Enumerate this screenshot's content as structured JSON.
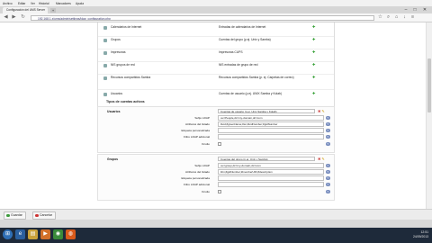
{
  "browser": {
    "menu": [
      "Archivo",
      "Editar",
      "Ver",
      "Historial",
      "Marcadores",
      "Ayuda"
    ],
    "tab_title": "Configuración del UMS Server",
    "new_tab_icon": "plus-icon",
    "url": "192.168.1.x/ums/admin/settings/ldap_configuration.php"
  },
  "settings_table": {
    "rows": [
      {
        "name": "Calendarios de Internet",
        "desc": "Entradas de calendarios de Internet"
      },
      {
        "name": "Grupos",
        "desc": "Cuentas del grupo (p.ej. Unix y Samba)"
      },
      {
        "name": "Impresoras",
        "desc": "Impresoras CUPS"
      },
      {
        "name": "NIS grupos de red",
        "desc": "NIS entradas de grupo de red"
      },
      {
        "name": "Recursos compartidos Samba",
        "desc": "Recursos compartidos Samba (p. ej. Carpetas de correo)"
      },
      {
        "name": "Usuarios",
        "desc": "Cuentas de usuario (p.ej. UNIX Samba y Kolab)"
      }
    ]
  },
  "section_title": "Tipos de cuentas activos",
  "groups": [
    {
      "name": "Usuarios",
      "description": "Cuentas de usuario (p.ej. Unix Samba y Kolab)",
      "fields": [
        {
          "label": "Sufijo LDAP",
          "value": "ou=People,dc=my-domain,dc=com"
        },
        {
          "label": "Atributos del listado",
          "value": "#uid;#givenName;#sn;#uidNumber;#gidNumber"
        },
        {
          "label": "Etiqueta personalizada",
          "value": ""
        },
        {
          "label": "Filtro LDAP adicional",
          "value": ""
        },
        {
          "label": "Oculto",
          "value": ""
        }
      ]
    },
    {
      "name": "Grupos",
      "description": "Cuentas del grupo (p.ej. Unix y Samba)",
      "fields": [
        {
          "label": "Sufijo LDAP",
          "value": "ou=group,dc=my-domain,dc=com"
        },
        {
          "label": "Atributos del listado",
          "value": "#cn;#gidNumber;#memberUID;#description"
        },
        {
          "label": "Etiqueta personalizada",
          "value": ""
        },
        {
          "label": "Filtro LDAP adicional",
          "value": ""
        },
        {
          "label": "Oculto",
          "value": ""
        }
      ]
    }
  ],
  "footer": {
    "save_label": "Guardar",
    "cancel_label": "Cancelar"
  },
  "taskbar": {
    "apps": [
      "start-orb",
      "ie-icon",
      "explorer-icon",
      "media-icon",
      "chrome-icon",
      "firefox-icon"
    ],
    "time": "12:51",
    "date": "24/09/2013"
  },
  "colors": {
    "check_green": "#2a9a2a",
    "taskbar_bg": "#1e2a3a"
  }
}
